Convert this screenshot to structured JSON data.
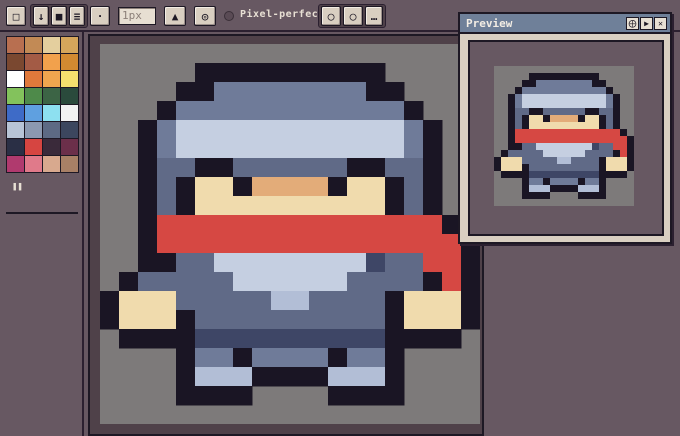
{
  "toolbar": {
    "brush_size_value": "1px",
    "pixel_perfect_label": "Pixel-perfect",
    "more_label": "…"
  },
  "palette": {
    "colors": [
      "#b86f50",
      "#c28a55",
      "#e4cf9e",
      "#d5a65b",
      "#7a4830",
      "#a35b45",
      "#f2a14c",
      "#d28a31",
      "#ffffff",
      "#e0793b",
      "#efa54f",
      "#f5e06e",
      "#83c25c",
      "#4e8a4a",
      "#3c6445",
      "#2a4a3c",
      "#3e6bc7",
      "#5fa0e0",
      "#8de0f0",
      "#f2f2f2",
      "#b8c4d6",
      "#8c99b0",
      "#5d6a84",
      "#3c465e",
      "#2a2f45",
      "#d64541",
      "#3a2a3a",
      "#6b2f4a",
      "#b03a6e",
      "#e07a8a",
      "#d8a98e",
      "#a88066"
    ]
  },
  "preview": {
    "title": "Preview"
  },
  "sprite": {
    "colors": {
      "K": "#1a1524",
      "D": "#606a87",
      "M": "#6f7b99",
      "L": "#c5cfe1",
      "N": "#3e4666",
      "R": "#d64843",
      "S": "#f0dbad",
      "O": "#e3ac79",
      "W": "#b2bed6"
    }
  }
}
